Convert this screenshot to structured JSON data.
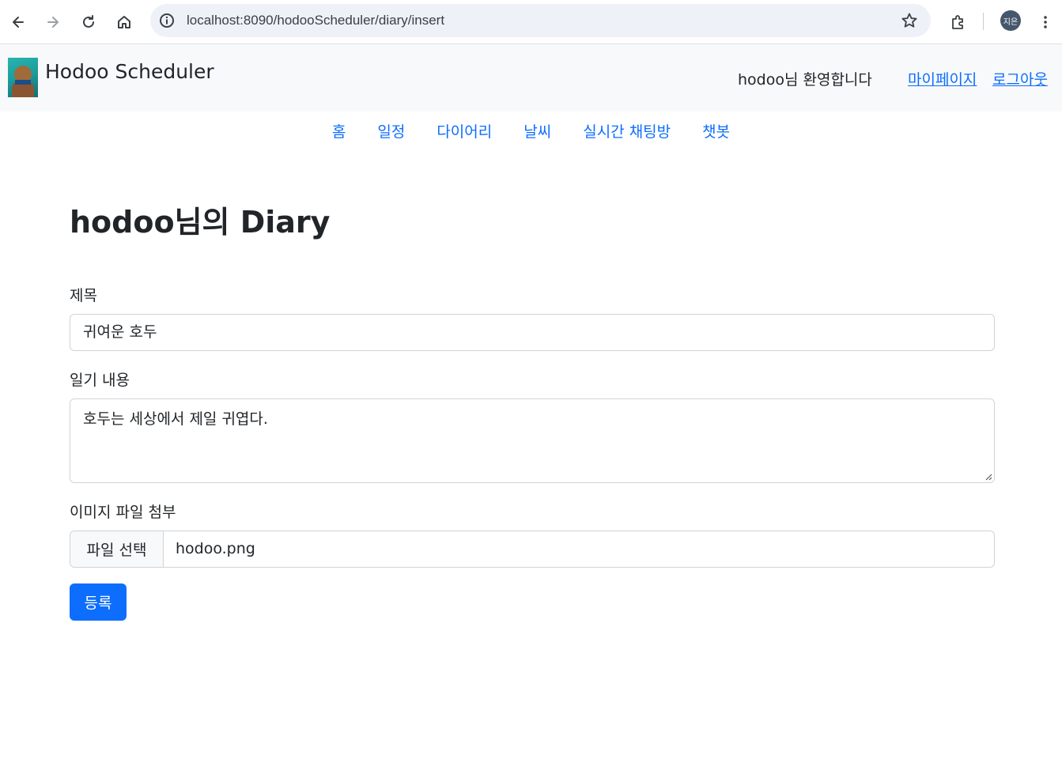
{
  "browser": {
    "url": "localhost:8090/hodooScheduler/diary/insert",
    "profile_initials": "지은"
  },
  "header": {
    "brand": "Hodoo Scheduler",
    "welcome": "hodoo님 환영합니다",
    "mypage": "마이페이지",
    "logout": "로그아웃"
  },
  "nav": {
    "items": [
      "홈",
      "일정",
      "다이어리",
      "날씨",
      "실시간 채팅방",
      "챗봇"
    ]
  },
  "main": {
    "title": "hodoo님의 Diary",
    "title_label": "제목",
    "title_value": "귀여운 호두",
    "content_label": "일기 내용",
    "content_value": "호두는 세상에서 제일 귀엽다.",
    "file_label": "이미지 파일 첨부",
    "file_button": "파일 선택",
    "file_name": "hodoo.png",
    "submit": "등록"
  },
  "colors": {
    "primary": "#0d6efd",
    "header_bg": "#f8f9fa",
    "omnibox_bg": "#eef1f8"
  }
}
